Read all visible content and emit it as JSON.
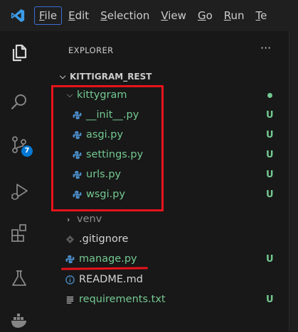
{
  "menu": {
    "items": [
      {
        "label": "File",
        "key": "F",
        "rest": "ile"
      },
      {
        "label": "Edit",
        "key": "E",
        "rest": "dit"
      },
      {
        "label": "Selection",
        "key": "S",
        "rest": "election"
      },
      {
        "label": "View",
        "key": "V",
        "rest": "iew"
      },
      {
        "label": "Go",
        "key": "G",
        "rest": "o"
      },
      {
        "label": "Run",
        "key": "R",
        "rest": "un"
      },
      {
        "label": "Te",
        "key": "T",
        "rest": "e"
      }
    ]
  },
  "activity_bar": {
    "icons": [
      "files-icon",
      "search-icon",
      "source-control-icon",
      "run-debug-icon",
      "extensions-icon",
      "testing-icon",
      "docker-icon"
    ],
    "source_control_badge": "7"
  },
  "explorer": {
    "header": "EXPLORER",
    "more": "···",
    "project": "KITTIGRAM_REST",
    "tree": [
      {
        "label": "kittygram",
        "kind": "folder-open",
        "status": "dot",
        "color": "#73c991"
      },
      {
        "label": "__init__.py",
        "kind": "python",
        "status": "U",
        "color": "#73c991"
      },
      {
        "label": "asgi.py",
        "kind": "python",
        "status": "U",
        "color": "#73c991"
      },
      {
        "label": "settings.py",
        "kind": "python",
        "status": "U",
        "color": "#73c991"
      },
      {
        "label": "urls.py",
        "kind": "python",
        "status": "U",
        "color": "#73c991"
      },
      {
        "label": "wsgi.py",
        "kind": "python",
        "status": "U",
        "color": "#73c991"
      },
      {
        "label": "venv",
        "kind": "folder-closed",
        "status": "",
        "color": "#8b8b8b"
      },
      {
        "label": ".gitignore",
        "kind": "gitignore",
        "status": "",
        "color": "#d4d4d4"
      },
      {
        "label": "manage.py",
        "kind": "python",
        "status": "U",
        "color": "#73c991"
      },
      {
        "label": "README.md",
        "kind": "info",
        "status": "",
        "color": "#d4d4d4"
      },
      {
        "label": "requirements.txt",
        "kind": "text",
        "status": "U",
        "color": "#73c991"
      }
    ]
  },
  "colors": {
    "accent": "#0078d4",
    "untracked": "#73c991",
    "annotation": "#e8131b"
  }
}
